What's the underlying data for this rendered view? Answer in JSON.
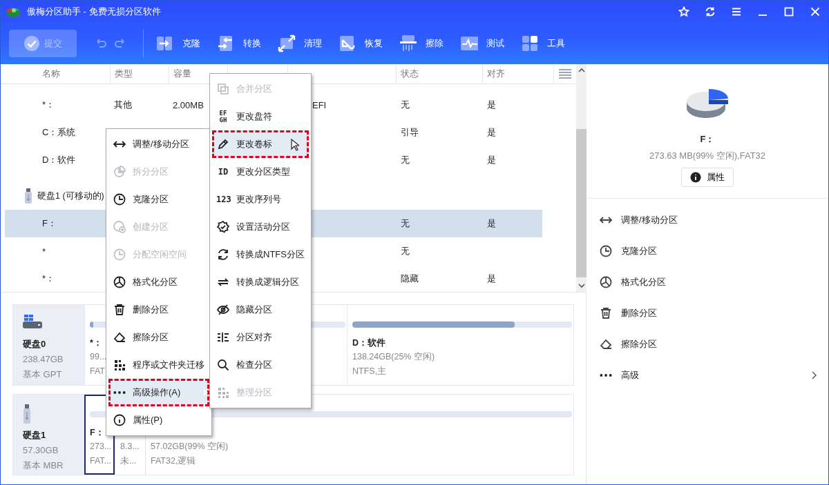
{
  "window": {
    "title": "傲梅分区助手 - 免费无损分区软件"
  },
  "toolbar": {
    "submit": {
      "label": "提交",
      "disabled": true
    },
    "history": [
      {
        "kind": "undo",
        "disabled": true
      },
      {
        "kind": "redo",
        "disabled": true
      }
    ],
    "tools": [
      {
        "label": "克隆"
      },
      {
        "label": "转换"
      },
      {
        "label": "清理"
      },
      {
        "label": "恢复"
      },
      {
        "label": "擦除"
      },
      {
        "label": "测试"
      },
      {
        "label": "工具"
      }
    ]
  },
  "table": {
    "header": {
      "name": "名称",
      "type": "类型",
      "capacity": "容量",
      "status": "状态",
      "align": "对齐"
    },
    "rows": [
      {
        "kind": "partition",
        "name": "*：",
        "type": "其他",
        "capacity": "2.00MB",
        "partition_type": "EFI",
        "status": "无",
        "align": "是",
        "selected": false
      },
      {
        "kind": "partition",
        "name": "C：系统",
        "status": "引导",
        "align": "是",
        "selected": false
      },
      {
        "kind": "partition",
        "name": "D：软件",
        "status": "无",
        "align": "是",
        "selected": false
      },
      {
        "kind": "disk",
        "name": "硬盘1 (可移动的)"
      },
      {
        "kind": "partition",
        "name": "F：",
        "status": "无",
        "align": "是",
        "selected": true
      },
      {
        "kind": "partition",
        "name": "*",
        "status": "无",
        "selected": false
      },
      {
        "kind": "partition",
        "name": "*：",
        "status": "隐藏",
        "align": "是",
        "selected": false
      }
    ]
  },
  "disks": [
    {
      "kind": "hdd",
      "name": "硬盘0",
      "size": "238.47GB",
      "style": "基本 GPT",
      "partitions": [
        {
          "name": "*：",
          "size": "99...",
          "fs": "FAT",
          "level": 0.15,
          "selected": false
        },
        {
          "selected": false
        },
        {
          "name": "D：软件",
          "size": "138.24GB(25% 空闲)",
          "fs": "NTFS,主",
          "level": 0.74,
          "selected": false
        }
      ]
    },
    {
      "kind": "usb",
      "name": "硬盘1",
      "size": "57.30GB",
      "style": "基本 MBR",
      "partitions": [
        {
          "size": "273...",
          "fs": "FAT...",
          "name": "F：",
          "selected": true
        },
        {
          "size": "8.3...",
          "fs": "未...",
          "selected": false
        },
        {
          "size": "57.02GB(99% 空闲)",
          "fs": "FAT32,逻辑",
          "selected": false
        }
      ]
    }
  ],
  "details": {
    "name": "F：",
    "info": "273.63 MB(99% 空闲),FAT32",
    "button": "属性"
  },
  "actions": [
    {
      "label": "调整/移动分区"
    },
    {
      "label": "克隆分区"
    },
    {
      "label": "格式化分区"
    },
    {
      "label": "删除分区"
    },
    {
      "label": "擦除分区"
    },
    {
      "label": "高级",
      "submenu": true
    }
  ],
  "context_menu": {
    "items": [
      {
        "label": "调整/移动分区",
        "disabled": false,
        "highlighted": false
      },
      {
        "label": "拆分分区",
        "disabled": true,
        "highlighted": false
      },
      {
        "label": "克隆分区",
        "disabled": false,
        "highlighted": false
      },
      {
        "label": "创建分区",
        "disabled": true,
        "highlighted": false
      },
      {
        "label": "分配空闲空间",
        "disabled": true,
        "highlighted": false
      },
      {
        "label": "格式化分区",
        "disabled": false,
        "highlighted": false
      },
      {
        "label": "删除分区",
        "disabled": false,
        "highlighted": false
      },
      {
        "label": "擦除分区",
        "disabled": false,
        "highlighted": false
      },
      {
        "label": "程序或文件夹迁移",
        "disabled": false,
        "highlighted": false
      },
      {
        "label": "高级操作(A)",
        "disabled": false,
        "highlighted": true,
        "submenu": true
      },
      {
        "label": "属性(P)",
        "disabled": false,
        "highlighted": false
      }
    ]
  },
  "submenu": {
    "items": [
      {
        "label": "合并分区",
        "disabled": true,
        "highlighted": false
      },
      {
        "label": "更改盘符",
        "glyph": "EF\nGH",
        "disabled": false,
        "highlighted": false
      },
      {
        "label": "更改卷标",
        "disabled": false,
        "highlighted": true,
        "pointer": true
      },
      {
        "label": "更改分区类型",
        "glyph": "ID",
        "disabled": false,
        "highlighted": false
      },
      {
        "label": "更改序列号",
        "glyph": "123",
        "disabled": false,
        "highlighted": false
      },
      {
        "label": "设置活动分区",
        "disabled": false,
        "highlighted": false
      },
      {
        "label": "转换成NTFS分区",
        "disabled": false,
        "highlighted": false
      },
      {
        "label": "转换成逻辑分区",
        "disabled": false,
        "highlighted": false
      },
      {
        "label": "隐藏分区",
        "disabled": false,
        "highlighted": false
      },
      {
        "label": "分区对齐",
        "disabled": false,
        "highlighted": false
      },
      {
        "label": "检查分区",
        "disabled": false,
        "highlighted": false
      },
      {
        "label": "整理分区",
        "disabled": true,
        "highlighted": false
      }
    ]
  }
}
